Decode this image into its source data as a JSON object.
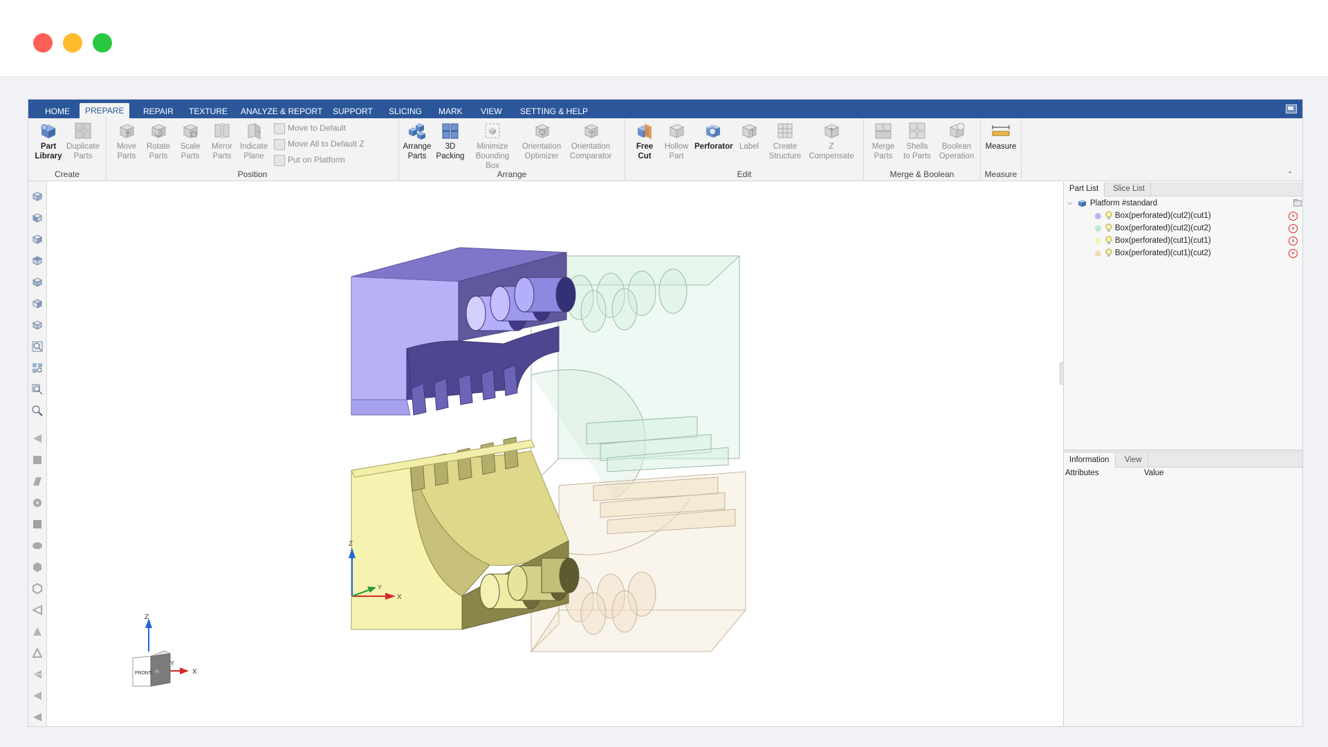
{
  "window": {
    "traffic_lights": [
      "close",
      "minimize",
      "zoom"
    ]
  },
  "menu_tabs": [
    {
      "label": "HOME",
      "active": false
    },
    {
      "label": "PREPARE",
      "active": true
    },
    {
      "label": "REPAIR",
      "active": false
    },
    {
      "label": "TEXTURE",
      "active": false
    },
    {
      "label": "ANALYZE & REPORT",
      "active": false
    },
    {
      "label": "SUPPORT",
      "active": false
    },
    {
      "label": "SLICING",
      "active": false
    },
    {
      "label": "MARK",
      "active": false
    },
    {
      "label": "VIEW",
      "active": false
    },
    {
      "label": "SETTING & HELP",
      "active": false
    }
  ],
  "ribbon": {
    "create": {
      "label": "Create",
      "part_library": [
        "Part",
        "Library"
      ],
      "duplicate_parts": [
        "Duplicate",
        "Parts"
      ]
    },
    "position": {
      "label": "Position",
      "move_parts": [
        "Move",
        "Parts"
      ],
      "rotate_parts": [
        "Rotate",
        "Parts"
      ],
      "scale_parts": [
        "Scale",
        "Parts"
      ],
      "mirror_parts": [
        "Mirror",
        "Parts"
      ],
      "indicate_plane": [
        "Indicate",
        "Plane"
      ],
      "move_to_default": "Move to Default",
      "move_all_to_default_z": "Move All to Default Z",
      "put_on_platform": "Put on Platform"
    },
    "arrange": {
      "label": "Arrange",
      "arrange_parts": [
        "Arrange",
        "Parts"
      ],
      "packing_3d": [
        "3D",
        "Packing"
      ],
      "minimize_bounding_box": [
        "Minimize",
        "Bounding Box"
      ],
      "orientation_optimizer": [
        "Orientation",
        "Optimizer"
      ],
      "orientation_comparator": [
        "Orientation",
        "Comparator"
      ]
    },
    "edit": {
      "label": "Edit",
      "free_cut": [
        "Free",
        "Cut"
      ],
      "hollow_part": [
        "Hollow",
        "Part"
      ],
      "perforator": "Perforator",
      "label_btn": "Label",
      "create_structure": [
        "Create",
        "Structure"
      ],
      "z_compensate": [
        "Z",
        "Compensate"
      ]
    },
    "merge_boolean": {
      "label": "Merge & Boolean",
      "merge_parts": [
        "Merge",
        "Parts"
      ],
      "shells_to_parts": [
        "Shells",
        "to Parts"
      ],
      "boolean_operation": [
        "Boolean",
        "Operation"
      ]
    },
    "measure": {
      "label": "Measure",
      "measure": "Measure"
    }
  },
  "viewport": {
    "axis_labels": {
      "z": "Z",
      "y": "Y",
      "x": "X"
    },
    "cube_face": "FRONT",
    "cube_side": "RI"
  },
  "panel": {
    "tabs": [
      {
        "label": "Part List",
        "active": true
      },
      {
        "label": "Slice List",
        "active": false
      }
    ],
    "platform": "Platform #standard",
    "parts": [
      {
        "name": "Box(perforated)(cut2)(cut1)",
        "color": "#b8b6ee"
      },
      {
        "name": "Box(perforated)(cut2)(cut2)",
        "color": "#bfe8cf"
      },
      {
        "name": "Box(perforated)(cut1)(cut1)",
        "color": "#f5f3b4"
      },
      {
        "name": "Box(perforated)(cut1)(cut2)",
        "color": "#f1dcb5"
      }
    ],
    "info_tabs": [
      {
        "label": "Information",
        "active": true
      },
      {
        "label": "View",
        "active": false
      }
    ],
    "info_columns": [
      "Attributes",
      "Value"
    ]
  }
}
